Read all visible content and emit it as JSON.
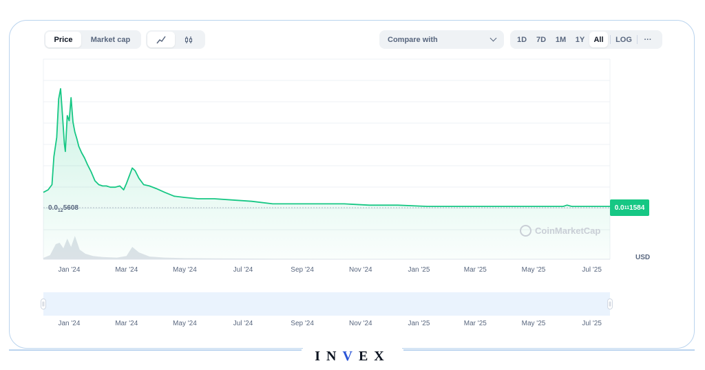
{
  "toolbar": {
    "price_label": "Price",
    "market_cap_label": "Market cap",
    "compare_label": "Compare with",
    "ranges": [
      "1D",
      "7D",
      "1M",
      "1Y",
      "All"
    ],
    "active_range": "All",
    "log_label": "LOG",
    "more_label": "···"
  },
  "price_labels": {
    "left_prefix": "0.0",
    "left_sub": "12",
    "left_suffix": "5608",
    "right_prefix": "0.0",
    "right_sub": "11",
    "right_suffix": "1584"
  },
  "currency": "USD",
  "watermark": "CoinMarketCap",
  "brand": {
    "pre": "IN",
    "v": "V",
    "post": "EX"
  },
  "colors": {
    "line": "#16c784",
    "badge": "#16c784",
    "frame": "#b9d3ee",
    "brand_v": "#2b55d6"
  },
  "chart_data": {
    "type": "area",
    "title": "",
    "xlabel": "",
    "ylabel": "",
    "x_ticks": [
      "Jan '24",
      "Mar '24",
      "May '24",
      "Jul '24",
      "Sep '24",
      "Nov '24",
      "Jan '25",
      "Mar '25",
      "May '25",
      "Jul '25"
    ],
    "x_range": [
      "2023-12-05",
      "2025-07-20"
    ],
    "series": [
      {
        "x": [
          "2023-12-05",
          "2023-12-10",
          "2023-12-14",
          "2023-12-16",
          "2023-12-19",
          "2023-12-21",
          "2023-12-23",
          "2023-12-25",
          "2023-12-27",
          "2023-12-28",
          "2023-12-30",
          "2024-01-01",
          "2024-01-03",
          "2024-01-05",
          "2024-01-07",
          "2024-01-09",
          "2024-01-11",
          "2024-01-14",
          "2024-01-17",
          "2024-01-20",
          "2024-01-24",
          "2024-01-28",
          "2024-02-01",
          "2024-02-05",
          "2024-02-09",
          "2024-02-13",
          "2024-02-18",
          "2024-02-23",
          "2024-02-27",
          "2024-03-01",
          "2024-03-04",
          "2024-03-07",
          "2024-03-10",
          "2024-03-14",
          "2024-03-19",
          "2024-03-25",
          "2024-04-01",
          "2024-04-10",
          "2024-04-20",
          "2024-05-01",
          "2024-05-15",
          "2024-06-01",
          "2024-06-20",
          "2024-07-10",
          "2024-08-01",
          "2024-08-25",
          "2024-09-20",
          "2024-10-15",
          "2024-11-10",
          "2024-12-10",
          "2025-01-10",
          "2025-02-10",
          "2025-03-10",
          "2025-04-10",
          "2025-05-10",
          "2025-06-01",
          "2025-06-05",
          "2025-06-10",
          "2025-07-01",
          "2025-07-20"
        ],
        "values": [
          0.12,
          0.14,
          0.18,
          0.4,
          0.55,
          0.85,
          0.93,
          0.72,
          0.5,
          0.44,
          0.72,
          0.68,
          0.86,
          0.67,
          0.59,
          0.54,
          0.48,
          0.43,
          0.39,
          0.34,
          0.28,
          0.21,
          0.18,
          0.17,
          0.17,
          0.16,
          0.16,
          0.17,
          0.14,
          0.19,
          0.25,
          0.31,
          0.29,
          0.23,
          0.18,
          0.17,
          0.15,
          0.12,
          0.09,
          0.08,
          0.07,
          0.07,
          0.06,
          0.05,
          0.03,
          0.03,
          0.03,
          0.03,
          0.02,
          0.02,
          0.01,
          0.01,
          0.01,
          0.01,
          0.01,
          0.01,
          0.02,
          0.01,
          0.01,
          0.01
        ]
      }
    ],
    "volume": {
      "x": [
        "2023-12-05",
        "2023-12-12",
        "2023-12-18",
        "2023-12-22",
        "2023-12-26",
        "2023-12-30",
        "2024-01-03",
        "2024-01-07",
        "2024-01-12",
        "2024-01-18",
        "2024-01-26",
        "2024-02-05",
        "2024-02-20",
        "2024-03-01",
        "2024-03-07",
        "2024-03-14",
        "2024-03-25",
        "2024-04-10",
        "2024-05-01",
        "2024-06-01",
        "2024-08-01",
        "2024-12-01",
        "2025-07-20"
      ],
      "values": [
        0.05,
        0.15,
        0.55,
        0.6,
        0.4,
        0.75,
        0.45,
        0.85,
        0.35,
        0.2,
        0.12,
        0.08,
        0.06,
        0.12,
        0.45,
        0.25,
        0.1,
        0.06,
        0.04,
        0.03,
        0.02,
        0.01,
        0.01
      ]
    },
    "grid": true,
    "legend": "none"
  }
}
